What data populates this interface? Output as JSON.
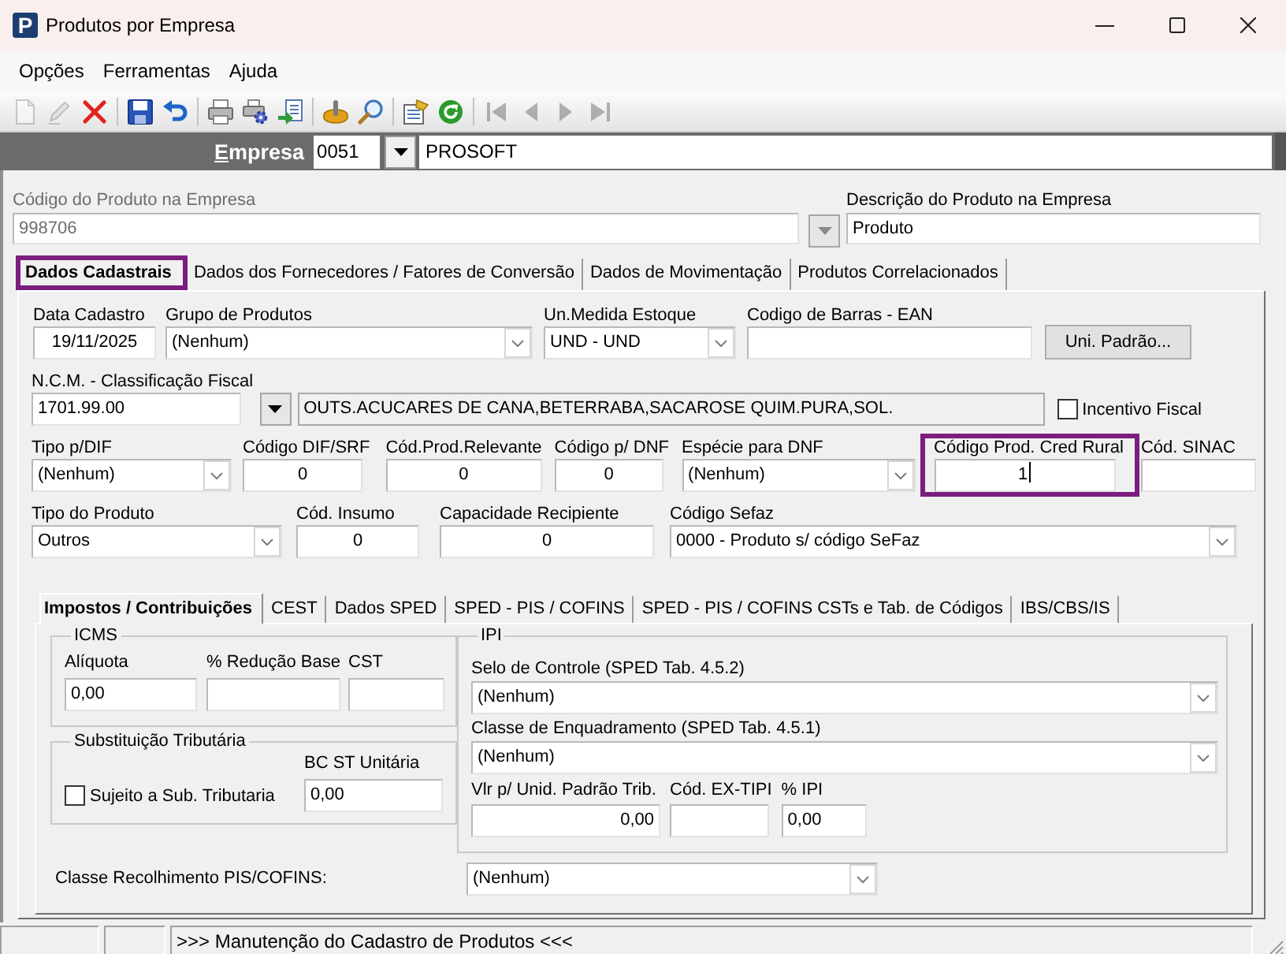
{
  "window": {
    "title": "Produtos por Empresa",
    "logo_text": "P"
  },
  "menu": [
    {
      "label": "Opções"
    },
    {
      "label": "Ferramentas"
    },
    {
      "label": "Ajuda"
    }
  ],
  "toolbar": [
    {
      "items": [
        {
          "kind": "new",
          "disabled": true
        },
        {
          "kind": "edit",
          "disabled": true
        },
        {
          "kind": "delete",
          "disabled": false
        }
      ]
    },
    {
      "items": [
        {
          "kind": "save",
          "disabled": false
        },
        {
          "kind": "undo",
          "disabled": false
        }
      ]
    },
    {
      "items": [
        {
          "kind": "print",
          "disabled": false
        },
        {
          "kind": "print_setup",
          "disabled": false
        },
        {
          "kind": "export",
          "disabled": false
        }
      ]
    },
    {
      "items": [
        {
          "kind": "tool",
          "disabled": false
        },
        {
          "kind": "search",
          "disabled": false
        }
      ]
    },
    {
      "items": [
        {
          "kind": "properties",
          "disabled": false
        },
        {
          "kind": "refresh",
          "disabled": false
        }
      ]
    },
    {
      "items": [
        {
          "kind": "first",
          "disabled": true
        },
        {
          "kind": "previous",
          "disabled": true
        },
        {
          "kind": "next",
          "disabled": true
        },
        {
          "kind": "last",
          "disabled": true
        }
      ]
    }
  ],
  "empresa": {
    "label": "Empresa",
    "code": "0051",
    "name": "PROSOFT"
  },
  "product": {
    "code": {
      "label": "Código do Produto na Empresa",
      "value": "998706",
      "disabled": true
    },
    "description": {
      "label": "Descrição do Produto na Empresa",
      "value": "Produto",
      "disabled": false
    }
  },
  "tabs": [
    {
      "label": "Dados Cadastrais",
      "selected": true,
      "highlighted": true
    },
    {
      "label": "Dados dos Fornecedores / Fatores de Conversão",
      "selected": false,
      "highlighted": false
    },
    {
      "label": "Dados de Movimentação",
      "selected": false,
      "highlighted": false
    },
    {
      "label": "Produtos Correlacionados",
      "selected": false,
      "highlighted": false
    }
  ],
  "general": {
    "lines": [
      {
        "fields": [
          {
            "kind": "text",
            "label": "Data Cadastro",
            "value": "19/11/2025"
          },
          {
            "kind": "combo",
            "label": "Grupo de Produtos",
            "value": "(Nenhum)"
          },
          {
            "kind": "combo",
            "label": "Un.Medida Estoque",
            "value": "UND - UND"
          },
          {
            "kind": "text",
            "label": "Codigo de Barras - EAN"
          },
          {
            "kind": "button",
            "label": "Uni. Padrão..."
          }
        ]
      },
      {
        "fields": [
          {
            "kind": "text",
            "label": "N.C.M. - Classificação Fiscal",
            "value": "1701.99.00"
          },
          {
            "kind": "dropdown"
          },
          {
            "kind": "readonly",
            "value": "OUTS.ACUCARES DE CANA,BETERRABA,SACAROSE QUIM.PURA,SOL."
          },
          {
            "kind": "checkbox",
            "label": "Incentivo Fiscal",
            "checked": false
          }
        ]
      },
      {
        "fields": [
          {
            "kind": "combo",
            "label": "Tipo p/DIF",
            "value": "(Nenhum)",
            "highlighted": false,
            "focused": false
          },
          {
            "kind": "text",
            "label": "Código DIF/SRF",
            "value": "0",
            "highlighted": false,
            "focused": false
          },
          {
            "kind": "text",
            "label": "Cód.Prod.Relevante",
            "value": "0",
            "highlighted": false,
            "focused": false
          },
          {
            "kind": "text",
            "label": "Código p/ DNF",
            "value": "0",
            "highlighted": false,
            "focused": false
          },
          {
            "kind": "combo",
            "label": "Espécie para DNF",
            "value": "(Nenhum)",
            "highlighted": false,
            "focused": false
          },
          {
            "kind": "text",
            "label": "Código Prod. Cred Rural",
            "value": "1",
            "highlighted": true,
            "focused": true
          },
          {
            "kind": "text",
            "label": "Cód. SINAC",
            "highlighted": false,
            "focused": false
          }
        ]
      },
      {
        "fields": [
          {
            "kind": "combo",
            "label": "Tipo do Produto",
            "value": "Outros"
          },
          {
            "kind": "text",
            "label": "Cód. Insumo",
            "value": "0"
          },
          {
            "kind": "text",
            "label": "Capacidade Recipiente",
            "value": "0"
          },
          {
            "kind": "combo",
            "label": "Código Sefaz",
            "value": "0000 - Produto s/ código SeFaz"
          }
        ]
      }
    ]
  },
  "subtabs": [
    {
      "label": "Impostos / Contribuições",
      "selected": true
    },
    {
      "label": "CEST",
      "selected": false
    },
    {
      "label": "Dados SPED",
      "selected": false
    },
    {
      "label": "SPED - PIS / COFINS",
      "selected": false
    },
    {
      "label": "SPED - PIS / COFINS CSTs e Tab. de Códigos",
      "selected": false
    },
    {
      "label": "IBS/CBS/IS",
      "selected": false
    }
  ],
  "taxes": {
    "icms": {
      "title": "ICMS",
      "fields": [
        {
          "label": "Alíquota",
          "value": "0,00"
        },
        {
          "label": "% Redução Base"
        },
        {
          "label": "CST"
        }
      ]
    },
    "substitution": {
      "title": "Substituição Tributária",
      "checkbox": {
        "label": "Sujeito a Sub. Tributaria",
        "checked": false
      },
      "field": {
        "label": "BC ST Unitária",
        "value": "0,00"
      }
    },
    "ipi": {
      "title": "IPI",
      "combos": [
        {
          "label": "Selo de Controle (SPED Tab. 4.5.2)",
          "value": "(Nenhum)"
        },
        {
          "label": "Classe de Enquadramento (SPED Tab. 4.5.1)",
          "value": "(Nenhum)"
        }
      ],
      "fields": [
        {
          "label": "Vlr p/ Unid. Padrão Trib.",
          "value": "0,00"
        },
        {
          "label": "Cód. EX-TIPI"
        },
        {
          "label": "% IPI",
          "value": "0,00"
        }
      ]
    },
    "pis_cofins": {
      "label": "Classe Recolhimento PIS/COFINS:",
      "value": "(Nenhum)"
    }
  },
  "status_bar": {
    "message": ">>> Manutenção do Cadastro de Produtos <<<"
  }
}
